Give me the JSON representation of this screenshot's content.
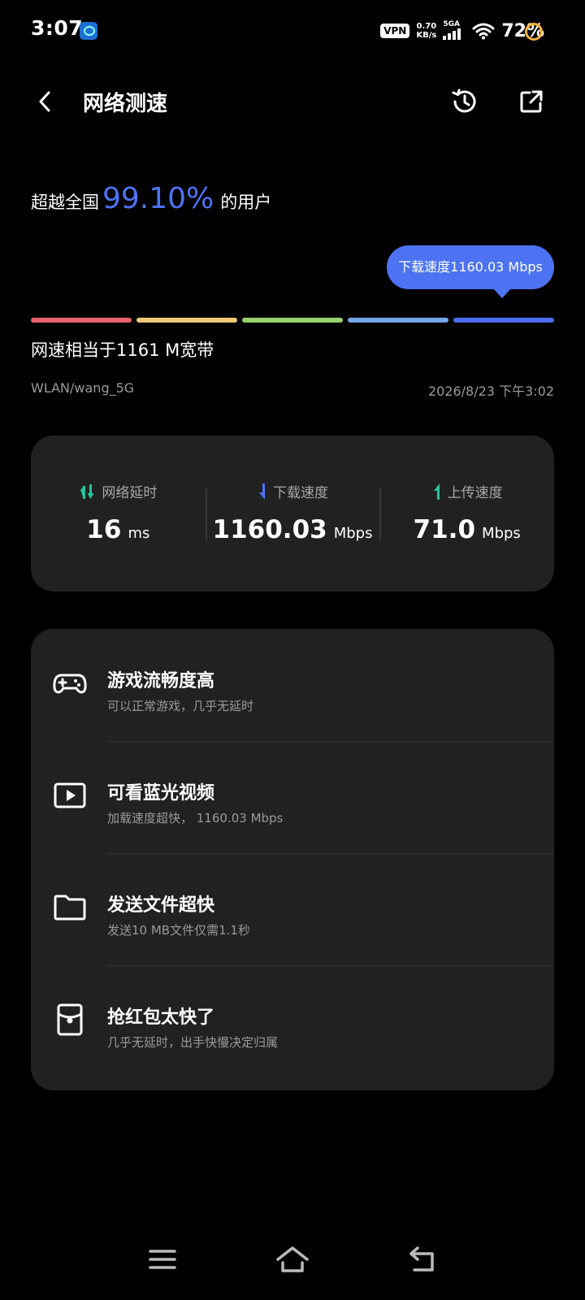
{
  "status_bar": {
    "time": "3:07",
    "vpn": "VPN",
    "net_speed_value": "0.70",
    "net_speed_unit": "KB/s",
    "network_type": "5GA",
    "battery": "72%"
  },
  "header": {
    "title": "网络测速"
  },
  "summary": {
    "percentile_prefix": "超越全国",
    "percentile_value": "99.10%",
    "percentile_suffix": "的用户",
    "tooltip": "下载速度1160.03 Mbps",
    "equivalent": "网速相当于1161 M宽带",
    "network_name": "WLAN/wang_5G",
    "test_time": "2026/8/23 下午3:02",
    "scale_colors": [
      "#e8616e",
      "#f1c978",
      "#96d36b",
      "#76a5ea",
      "#4a6cf0"
    ]
  },
  "metrics": {
    "latency": {
      "label": "网络延时",
      "value": "16",
      "unit": "ms",
      "icon_color": "#24c49a"
    },
    "download": {
      "label": "下载速度",
      "value": "1160.03",
      "unit": "Mbps",
      "icon_color": "#4d73f3"
    },
    "upload": {
      "label": "上传速度",
      "value": "71.0",
      "unit": "Mbps",
      "icon_color": "#24c49a"
    }
  },
  "features": [
    {
      "icon": "gamepad-icon",
      "title": "游戏流畅度高",
      "subtitle": "可以正常游戏，几乎无延时"
    },
    {
      "icon": "video-play-icon",
      "title": "可看蓝光视频",
      "subtitle": "加载速度超快， 1160.03 Mbps"
    },
    {
      "icon": "folder-icon",
      "title": "发送文件超快",
      "subtitle": "发送10 MB文件仅需1.1秒"
    },
    {
      "icon": "red-envelope-icon",
      "title": "抢红包太快了",
      "subtitle": "几乎无延时，出手快慢决定归属"
    }
  ],
  "colors": {
    "accent": "#4d73f3",
    "card": "#212121",
    "muted_text": "#9a9a9a"
  }
}
